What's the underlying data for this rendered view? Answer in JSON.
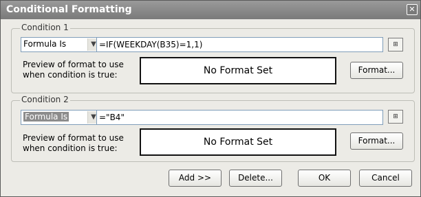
{
  "window": {
    "title": "Conditional Formatting",
    "close_glyph": "✕"
  },
  "conditions": [
    {
      "legend": "Condition 1",
      "select_value": "Formula Is",
      "formula": "=IF(WEEKDAY(B35)=1,1)",
      "preview_label_line1": "Preview of format to use",
      "preview_label_line2": "when condition is true:",
      "preview_text": "No Format Set",
      "format_button": "Format..."
    },
    {
      "legend": "Condition 2",
      "select_value": "Formula Is",
      "formula": "=\"B4\"",
      "preview_label_line1": "Preview of format to use",
      "preview_label_line2": "when condition is true:",
      "preview_text": "No Format Set",
      "format_button": "Format..."
    }
  ],
  "footer": {
    "add_button": "Add >>",
    "delete_button": "Delete...",
    "ok_button": "OK",
    "cancel_button": "Cancel"
  },
  "icons": {
    "dropdown": "chevron-down-icon",
    "range_ref": "collapse-dialog-icon",
    "close": "close-icon"
  }
}
